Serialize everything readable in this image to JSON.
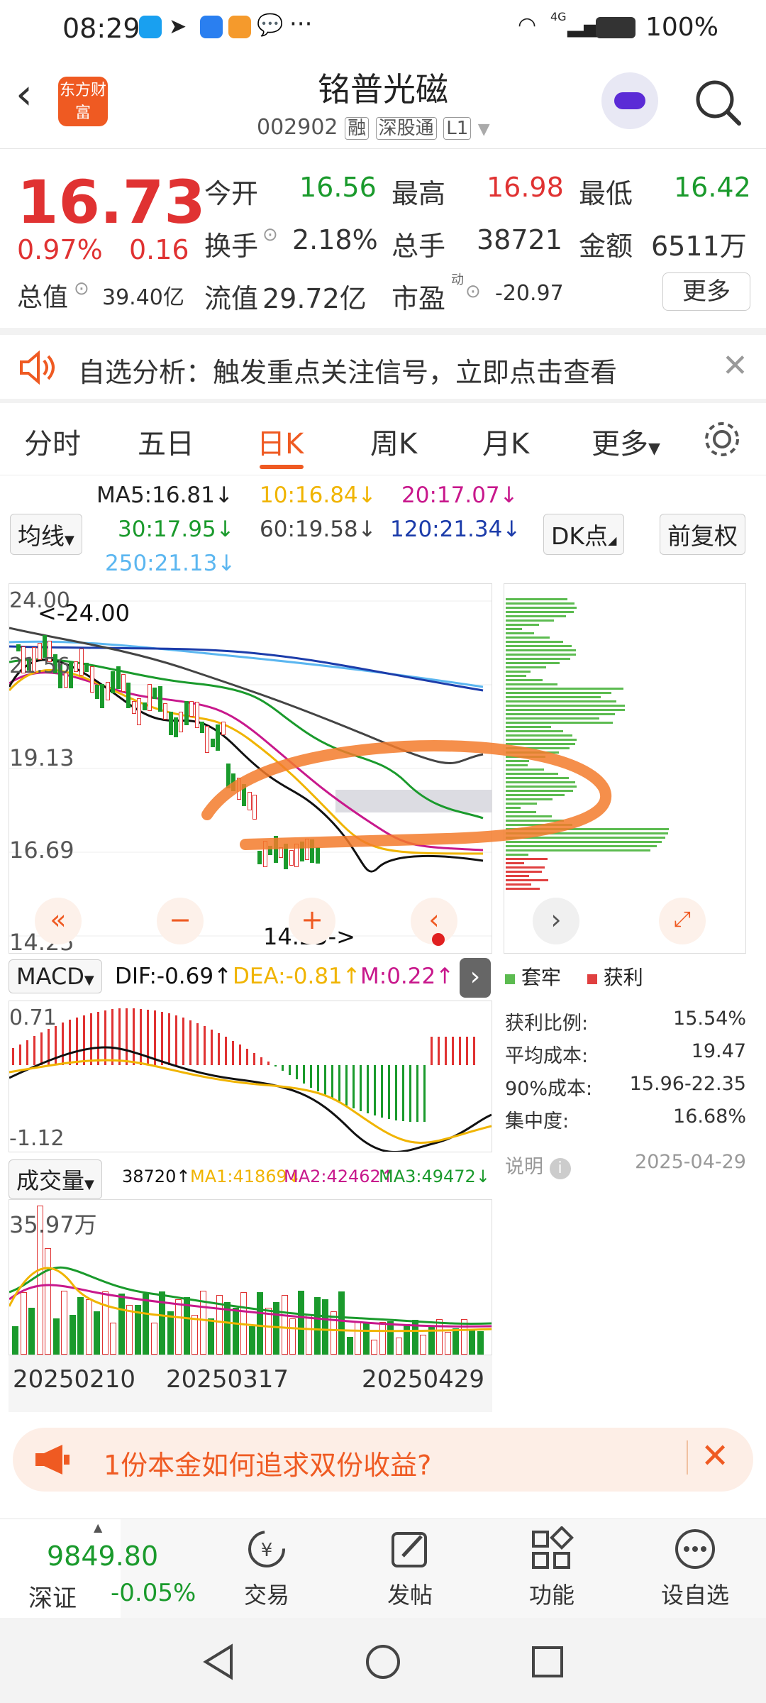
{
  "status_bar": {
    "time": "08:29",
    "battery": "100%",
    "network": "4G"
  },
  "header": {
    "title": "铭普光磁",
    "code": "002902",
    "tags": [
      "融",
      "深股通",
      "L1"
    ],
    "logo_text": "东方财富"
  },
  "quote": {
    "price": "16.73",
    "change_pct": "0.97%",
    "change": "0.16",
    "open_label": "今开",
    "open": "16.56",
    "high_label": "最高",
    "high": "16.98",
    "low_label": "最低",
    "low": "16.42",
    "turnover_label": "换手",
    "turnover": "2.18%",
    "volume_label": "总手",
    "volume": "38721",
    "amount_label": "金额",
    "amount": "6511万",
    "mktcap_label": "总值",
    "mktcap": "39.40亿",
    "float_label": "流值",
    "float": "29.72亿",
    "pe_label": "市盈",
    "pe_sup": "动",
    "pe": "-20.97",
    "more_label": "更多"
  },
  "notice": {
    "text": "自选分析：触发重点关注信号，立即点击查看"
  },
  "tabs": [
    "分时",
    "五日",
    "日K",
    "周K",
    "月K",
    "更多"
  ],
  "active_tab": "日K",
  "ma": {
    "selector": "均线",
    "ma5": "MA5:16.81↓",
    "ma10": "10:16.84↓",
    "ma20": "20:17.07↓",
    "ma30": "30:17.95↓",
    "ma60": "60:19.58↓",
    "ma120": "120:21.34↓",
    "ma250": "250:21.13↓",
    "dk": "DK点",
    "fq": "前复权"
  },
  "kchart": {
    "y_labels": [
      "24.00",
      "21.56",
      "19.13",
      "16.69",
      "14.25"
    ],
    "max_marker": "<-24.00",
    "min_marker": "14.25->"
  },
  "macd": {
    "selector": "MACD",
    "dif": "DIF:-0.69↑",
    "dea": "DEA:-0.81↑",
    "m": "M:0.22↑",
    "top": "0.71",
    "bottom": "-1.12"
  },
  "volume": {
    "selector": "成交量",
    "value": "38720↑",
    "ma1": "MA1:41869↓",
    "ma2": "MA2:42462↑",
    "ma3": "MA3:49472↓",
    "top": "35.97万",
    "dates": [
      "20250210",
      "20250317",
      "20250429"
    ]
  },
  "chip_legend": {
    "trapped": "套牢",
    "profit": "获利"
  },
  "chip_stats": [
    {
      "label": "获利比例:",
      "value": "15.54%"
    },
    {
      "label": "平均成本:",
      "value": "19.47"
    },
    {
      "label": "90%成本:",
      "value": "15.96-22.35"
    },
    {
      "label": "集中度:",
      "value": "16.68%"
    }
  ],
  "chip_footer": {
    "label": "说明",
    "date": "2025-04-29"
  },
  "ad": {
    "text": "1份本金如何追求双份收益?"
  },
  "bottom_nav": {
    "index_value": "9849.80",
    "index_name": "深证",
    "index_change": "-0.05%",
    "items": [
      "交易",
      "发帖",
      "功能",
      "设自选"
    ]
  },
  "colors": {
    "up": "#e03232",
    "down": "#1a9a2c",
    "accent": "#ef5a22"
  }
}
